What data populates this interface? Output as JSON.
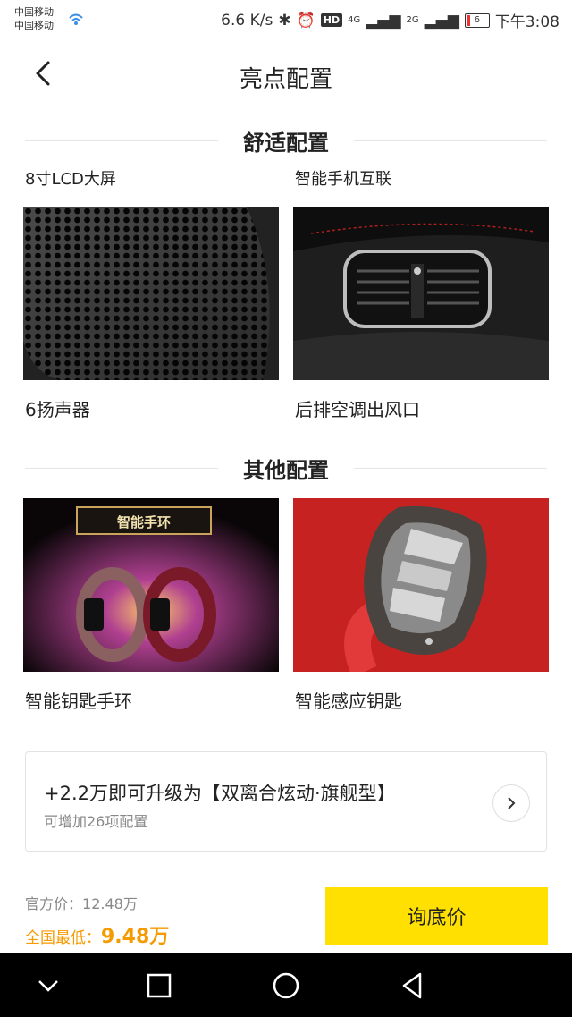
{
  "status": {
    "carrier1": "中国移动",
    "carrier2": "中国移动",
    "speed": "6.6 K/s",
    "hd": "HD",
    "net1": "4G",
    "net2": "2G",
    "battery": "6",
    "time": "下午3:08"
  },
  "header": {
    "title": "亮点配置"
  },
  "sections": [
    {
      "title": "舒适配置",
      "top_captions": [
        "8寸LCD大屏",
        "智能手机互联"
      ],
      "items": [
        {
          "caption": "6扬声器"
        },
        {
          "caption": "后排空调出风口"
        }
      ]
    },
    {
      "title": "其他配置",
      "items": [
        {
          "caption": "智能钥匙手环",
          "image_text": "智能手环"
        },
        {
          "caption": "智能感应钥匙"
        }
      ]
    }
  ],
  "upgrade": {
    "title": "+2.2万即可升级为【双离合炫动·旗舰型】",
    "subtitle": "可增加26项配置"
  },
  "price": {
    "official_label": "官方价：",
    "official_value": "12.48万",
    "lowest_label": "全国最低：",
    "lowest_value": "9.48万",
    "button": "询底价"
  },
  "colors": {
    "accent_yellow": "#ffe000",
    "price_orange": "#f59a00"
  }
}
